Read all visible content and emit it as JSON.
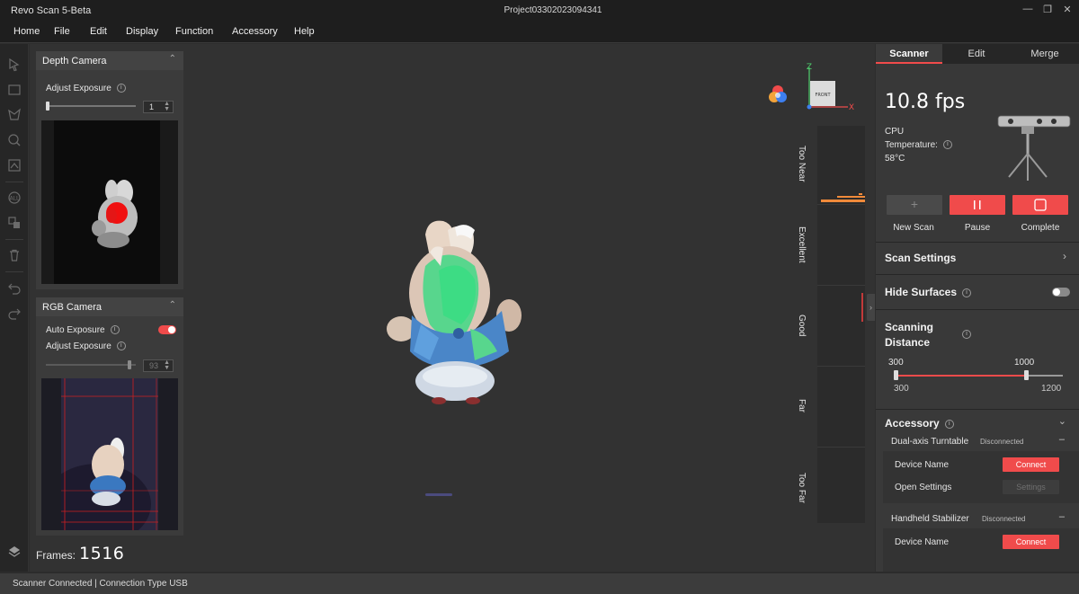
{
  "app": {
    "title": "Revo Scan 5-Beta",
    "project": "Project03302023094341"
  },
  "menu": [
    "Home",
    "File",
    "Edit",
    "Display",
    "Function",
    "Accessory",
    "Help"
  ],
  "toolbar_icons": [
    "select-icon",
    "rect-select-icon",
    "lasso-icon",
    "brush-select-icon",
    "invert-select-icon",
    "select-all-icon",
    "transfer-icon",
    "delete-icon",
    "undo-icon",
    "redo-icon",
    "layers-icon"
  ],
  "depth_camera": {
    "title": "Depth Camera",
    "exposure_label": "Adjust Exposure",
    "exposure_value": "1",
    "exposure_level": 0.0
  },
  "rgb_camera": {
    "title": "RGB Camera",
    "auto_exposure_label": "Auto Exposure",
    "auto_exposure_on": true,
    "exposure_label": "Adjust Exposure",
    "exposure_value": "93",
    "exposure_level": 0.93
  },
  "frames": {
    "label": "Frames:",
    "value": "1516"
  },
  "axis_gizmo": {
    "face": "FRONT",
    "z": "Z",
    "x": "X"
  },
  "quality_bar": [
    "Too Near",
    "Excellent",
    "Good",
    "Far",
    "Too Far"
  ],
  "right_panel": {
    "tabs": [
      "Scanner",
      "Edit",
      "Merge"
    ],
    "active_tab": "Scanner",
    "fps": "10.8 fps",
    "cpu_label": "CPU",
    "temperature_label": "Temperature:",
    "temperature": "58°C",
    "actions": [
      {
        "label": "New Scan",
        "icon": "plus-icon",
        "enabled": false
      },
      {
        "label": "Pause",
        "icon": "pause-icon",
        "enabled": true
      },
      {
        "label": "Complete",
        "icon": "stop-icon",
        "enabled": true
      }
    ],
    "scan_settings": "Scan Settings",
    "hide_surfaces": "Hide Surfaces",
    "hide_surfaces_on": false,
    "scanning_distance": {
      "label_line1": "Scanning",
      "label_line2": "Distance",
      "low_value": "300",
      "high_value": "1000",
      "min": "300",
      "max": "1200"
    },
    "accessory": {
      "title": "Accessory",
      "devices": [
        {
          "name": "Dual-axis Turntable",
          "status": "Disconnected",
          "rows": [
            {
              "label": "Device Name",
              "button": "Connect",
              "enabled": true
            },
            {
              "label": "Open Settings",
              "button": "Settings",
              "enabled": false
            }
          ]
        },
        {
          "name": "Handheld Stabilizer",
          "status": "Disconnected",
          "rows": [
            {
              "label": "Device Name",
              "button": "Connect",
              "enabled": true
            }
          ]
        }
      ]
    }
  },
  "colors": {
    "accent": "#f04b4b",
    "scan_green": "#3ddc84",
    "background": "#323232"
  },
  "status_bar": "Scanner Connected | Connection Type USB"
}
